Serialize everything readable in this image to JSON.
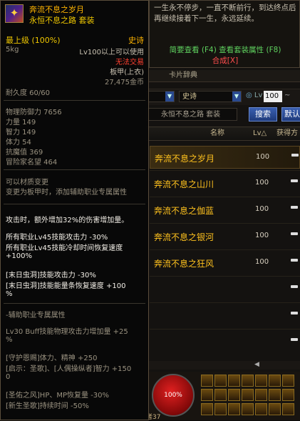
{
  "background_window": {
    "search": {
      "grade_value": "史诗",
      "lv_label": "Lv",
      "lv_min": "100",
      "lv_tilde": "~",
      "name_value": "永恒不息之路  套装",
      "search_button": "搜索",
      "default_button": "默认"
    },
    "table": {
      "col_name": "名称",
      "col_lv": "Lv△",
      "col_source": "获得方",
      "rows": [
        {
          "name": "奔流不息之岁月",
          "lv": "100"
        },
        {
          "name": "奔流不息之山川",
          "lv": "100"
        },
        {
          "name": "奔流不息之伽蓝",
          "lv": "100"
        },
        {
          "name": "奔流不息之银河",
          "lv": "100"
        },
        {
          "name": "奔流不息之狂风",
          "lv": "100"
        }
      ]
    },
    "hotbar": {
      "hp_percent": "100%",
      "corner_label": "者37"
    }
  },
  "right_panel": {
    "description": "一生永不停步，一直不断前行，到达终点后再继续接着下一生，永远延续。",
    "links": "简要查看 (F4) 查看套装属性 (F8)",
    "set_combine": "合成[X]",
    "tabs": [
      "卡片辞典"
    ]
  },
  "tooltip": {
    "item_name": "奔流不息之岁月",
    "set_name": "永恒不息之路  套装",
    "grade_top": "最上级 (100%)",
    "rarity": "史诗",
    "weight": "5kg",
    "level_req": "Lv100以上可以使用",
    "trade": "无法交易",
    "slot": "板甲(上衣)",
    "price": "27,475金币",
    "durability": "耐久度 60/60",
    "stats": [
      "物理防御力 7656",
      "力量 149",
      "智力 149",
      "体力 54",
      "抗魔值 369",
      "冒险家名望 464"
    ],
    "material_change": "可以材质变更",
    "material_note": "变更为板甲时，添加辅助职业专属属性",
    "effect_1": "攻击时，额外增加32%的伤害增加量。",
    "effect_2": [
      "所有职业Lv45技能攻击力 -30%",
      "所有职业Lv45技能冷却时间恢复速度",
      "+100%"
    ],
    "effect_3": [
      "[末日虫洞]技能攻击力 -30%",
      "[末日虫洞]技能能量条恢复速度 +100",
      "%"
    ],
    "aux_title": "-辅助职业专属属性",
    "aux_lines": [
      "Lv30 Buff技能物理攻击力增加量 +25",
      "%",
      "[守护恩赐]体力、精神 +250",
      "[启示：圣歌]、[人偶操纵者]智力 +150",
      "0",
      "[圣佑之风]HP、MP恢复量 -30%",
      "[新生圣歌]持续时间 -50%"
    ]
  }
}
